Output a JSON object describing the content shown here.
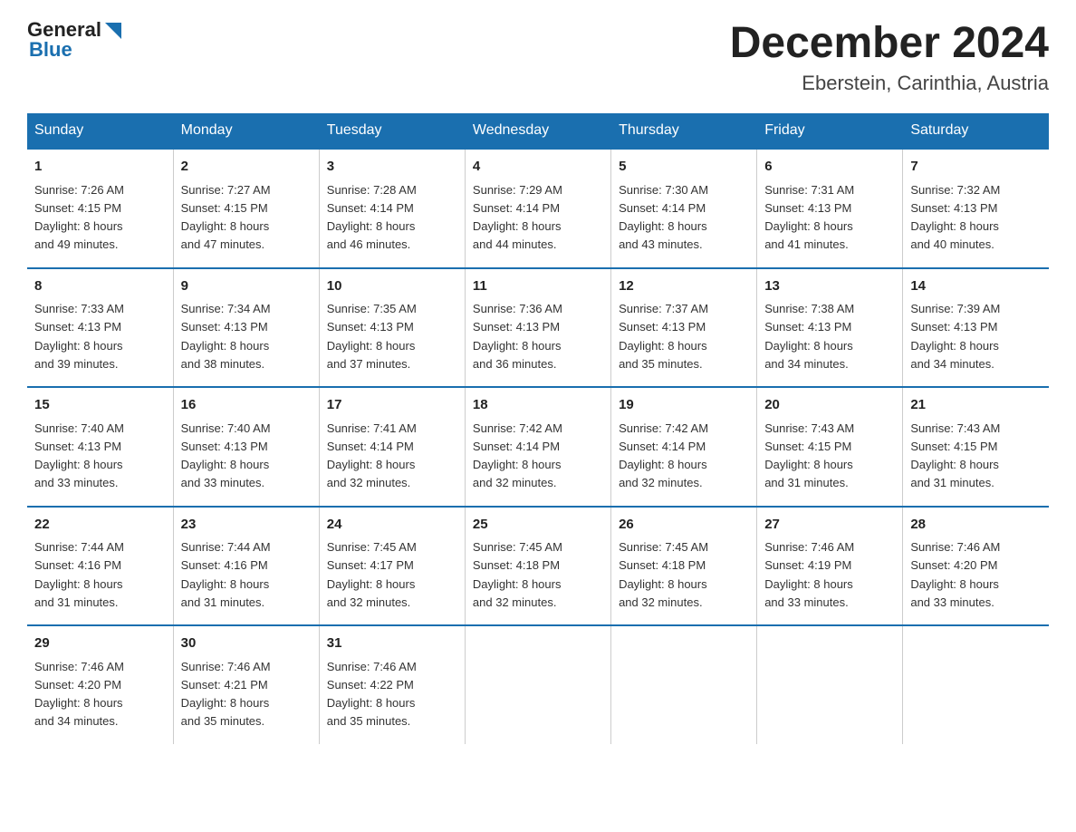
{
  "header": {
    "logo_line1": "General",
    "logo_line2": "Blue",
    "title": "December 2024",
    "subtitle": "Eberstein, Carinthia, Austria"
  },
  "days_of_week": [
    "Sunday",
    "Monday",
    "Tuesday",
    "Wednesday",
    "Thursday",
    "Friday",
    "Saturday"
  ],
  "weeks": [
    [
      {
        "day": "1",
        "sunrise": "7:26 AM",
        "sunset": "4:15 PM",
        "daylight": "8 hours and 49 minutes."
      },
      {
        "day": "2",
        "sunrise": "7:27 AM",
        "sunset": "4:15 PM",
        "daylight": "8 hours and 47 minutes."
      },
      {
        "day": "3",
        "sunrise": "7:28 AM",
        "sunset": "4:14 PM",
        "daylight": "8 hours and 46 minutes."
      },
      {
        "day": "4",
        "sunrise": "7:29 AM",
        "sunset": "4:14 PM",
        "daylight": "8 hours and 44 minutes."
      },
      {
        "day": "5",
        "sunrise": "7:30 AM",
        "sunset": "4:14 PM",
        "daylight": "8 hours and 43 minutes."
      },
      {
        "day": "6",
        "sunrise": "7:31 AM",
        "sunset": "4:13 PM",
        "daylight": "8 hours and 41 minutes."
      },
      {
        "day": "7",
        "sunrise": "7:32 AM",
        "sunset": "4:13 PM",
        "daylight": "8 hours and 40 minutes."
      }
    ],
    [
      {
        "day": "8",
        "sunrise": "7:33 AM",
        "sunset": "4:13 PM",
        "daylight": "8 hours and 39 minutes."
      },
      {
        "day": "9",
        "sunrise": "7:34 AM",
        "sunset": "4:13 PM",
        "daylight": "8 hours and 38 minutes."
      },
      {
        "day": "10",
        "sunrise": "7:35 AM",
        "sunset": "4:13 PM",
        "daylight": "8 hours and 37 minutes."
      },
      {
        "day": "11",
        "sunrise": "7:36 AM",
        "sunset": "4:13 PM",
        "daylight": "8 hours and 36 minutes."
      },
      {
        "day": "12",
        "sunrise": "7:37 AM",
        "sunset": "4:13 PM",
        "daylight": "8 hours and 35 minutes."
      },
      {
        "day": "13",
        "sunrise": "7:38 AM",
        "sunset": "4:13 PM",
        "daylight": "8 hours and 34 minutes."
      },
      {
        "day": "14",
        "sunrise": "7:39 AM",
        "sunset": "4:13 PM",
        "daylight": "8 hours and 34 minutes."
      }
    ],
    [
      {
        "day": "15",
        "sunrise": "7:40 AM",
        "sunset": "4:13 PM",
        "daylight": "8 hours and 33 minutes."
      },
      {
        "day": "16",
        "sunrise": "7:40 AM",
        "sunset": "4:13 PM",
        "daylight": "8 hours and 33 minutes."
      },
      {
        "day": "17",
        "sunrise": "7:41 AM",
        "sunset": "4:14 PM",
        "daylight": "8 hours and 32 minutes."
      },
      {
        "day": "18",
        "sunrise": "7:42 AM",
        "sunset": "4:14 PM",
        "daylight": "8 hours and 32 minutes."
      },
      {
        "day": "19",
        "sunrise": "7:42 AM",
        "sunset": "4:14 PM",
        "daylight": "8 hours and 32 minutes."
      },
      {
        "day": "20",
        "sunrise": "7:43 AM",
        "sunset": "4:15 PM",
        "daylight": "8 hours and 31 minutes."
      },
      {
        "day": "21",
        "sunrise": "7:43 AM",
        "sunset": "4:15 PM",
        "daylight": "8 hours and 31 minutes."
      }
    ],
    [
      {
        "day": "22",
        "sunrise": "7:44 AM",
        "sunset": "4:16 PM",
        "daylight": "8 hours and 31 minutes."
      },
      {
        "day": "23",
        "sunrise": "7:44 AM",
        "sunset": "4:16 PM",
        "daylight": "8 hours and 31 minutes."
      },
      {
        "day": "24",
        "sunrise": "7:45 AM",
        "sunset": "4:17 PM",
        "daylight": "8 hours and 32 minutes."
      },
      {
        "day": "25",
        "sunrise": "7:45 AM",
        "sunset": "4:18 PM",
        "daylight": "8 hours and 32 minutes."
      },
      {
        "day": "26",
        "sunrise": "7:45 AM",
        "sunset": "4:18 PM",
        "daylight": "8 hours and 32 minutes."
      },
      {
        "day": "27",
        "sunrise": "7:46 AM",
        "sunset": "4:19 PM",
        "daylight": "8 hours and 33 minutes."
      },
      {
        "day": "28",
        "sunrise": "7:46 AM",
        "sunset": "4:20 PM",
        "daylight": "8 hours and 33 minutes."
      }
    ],
    [
      {
        "day": "29",
        "sunrise": "7:46 AM",
        "sunset": "4:20 PM",
        "daylight": "8 hours and 34 minutes."
      },
      {
        "day": "30",
        "sunrise": "7:46 AM",
        "sunset": "4:21 PM",
        "daylight": "8 hours and 35 minutes."
      },
      {
        "day": "31",
        "sunrise": "7:46 AM",
        "sunset": "4:22 PM",
        "daylight": "8 hours and 35 minutes."
      },
      null,
      null,
      null,
      null
    ]
  ],
  "labels": {
    "sunrise": "Sunrise:",
    "sunset": "Sunset:",
    "daylight": "Daylight:"
  }
}
